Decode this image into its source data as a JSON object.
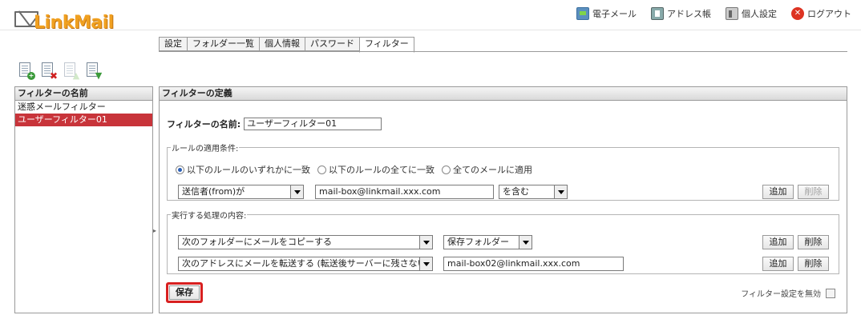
{
  "app": {
    "logo_text": "LinkMail"
  },
  "topnav": [
    {
      "label": "電子メール",
      "icon": "mail-icon"
    },
    {
      "label": "アドレス帳",
      "icon": "addressbook-icon"
    },
    {
      "label": "個人設定",
      "icon": "personal-settings-icon"
    },
    {
      "label": "ログアウト",
      "icon": "logout-icon"
    }
  ],
  "tabs": [
    {
      "label": "設定"
    },
    {
      "label": "フォルダー一覧"
    },
    {
      "label": "個人情報"
    },
    {
      "label": "パスワード"
    },
    {
      "label": "フィルター",
      "active": true
    }
  ],
  "left": {
    "header": "フィルターの名前",
    "items": [
      {
        "label": "迷惑メールフィルター"
      },
      {
        "label": "ユーザーフィルター01",
        "selected": true
      }
    ]
  },
  "right": {
    "header": "フィルターの定義",
    "name_label": "フィルターの名前:",
    "name_value": "ユーザーフィルター01",
    "rules": {
      "legend": "ルールの適用条件:",
      "radios": [
        {
          "label": "以下のルールのいずれかに一致",
          "checked": true
        },
        {
          "label": "以下のルールの全てに一致",
          "checked": false
        },
        {
          "label": "全てのメールに適用",
          "checked": false
        }
      ],
      "row": {
        "field_select": "送信者(from)が",
        "value": "mail-box@linkmail.xxx.com",
        "op_select": "を含む",
        "add_label": "追加",
        "delete_label": "削除"
      }
    },
    "actions": {
      "legend": "実行する処理の内容:",
      "rows": [
        {
          "action_select": "次のフォルダーにメールをコピーする",
          "target_select": "保存フォルダー",
          "add_label": "追加",
          "delete_label": "削除"
        },
        {
          "action_select": "次のアドレスにメールを転送する (転送後サーバーに残さない)",
          "target_value": "mail-box02@linkmail.xxx.com",
          "add_label": "追加",
          "delete_label": "削除"
        }
      ]
    },
    "save_label": "保存",
    "disable_label": "フィルター設定を無効"
  },
  "colors": {
    "accent_red": "#c8343a",
    "save_outline": "#d82020",
    "logo_orange": "#f0a020"
  }
}
